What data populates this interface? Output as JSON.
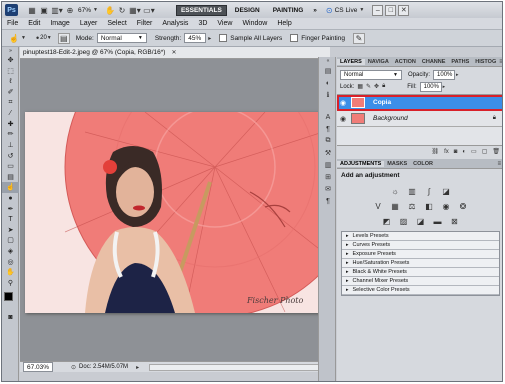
{
  "app": {
    "logo": "Ps",
    "zoom": "67%",
    "workspaces": [
      "ESSENTIALS",
      "DESIGN",
      "PAINTING"
    ],
    "more": "»",
    "cs_live": "CS Live"
  },
  "menu": [
    "File",
    "Edit",
    "Image",
    "Layer",
    "Select",
    "Filter",
    "Analysis",
    "3D",
    "View",
    "Window",
    "Help"
  ],
  "options": {
    "brush_size": "20",
    "mode_label": "Mode:",
    "mode_value": "Normal",
    "strength_label": "Strength:",
    "strength_value": "45%",
    "sample_all_layers": "Sample All Layers",
    "finger_painting": "Finger Painting"
  },
  "document": {
    "tab_title": "pinuptest18-Edit-2.jpeg @ 67% (Copia, RGB/16*)",
    "watermark": "Fischer Photo"
  },
  "status": {
    "zoom": "67.03%",
    "doc": "Doc: 2.54M/5.07M"
  },
  "layers_panel": {
    "tabs": [
      "LAYERS",
      "NAVIGA",
      "ACTION",
      "CHANNE",
      "PATHS",
      "HISTOG"
    ],
    "blend_mode": "Normal",
    "opacity_label": "Opacity:",
    "opacity_value": "100%",
    "lock_label": "Lock:",
    "fill_label": "Fill:",
    "fill_value": "100%",
    "layers": [
      {
        "name": "Copia",
        "selected": true
      },
      {
        "name": "Background",
        "selected": false
      }
    ]
  },
  "adjustments_panel": {
    "tabs": [
      "ADJUSTMENTS",
      "MASKS",
      "COLOR"
    ],
    "heading": "Add an adjustment",
    "presets": [
      "Levels Presets",
      "Curves Presets",
      "Exposure Presets",
      "Hue/Saturation Presets",
      "Black & White Presets",
      "Channel Mixer Presets",
      "Selective Color Presets"
    ]
  },
  "colors": {
    "accent_selected": "#3c8ee8",
    "highlight_box": "#d8202a",
    "photo_bg": "#f6d1d0"
  }
}
